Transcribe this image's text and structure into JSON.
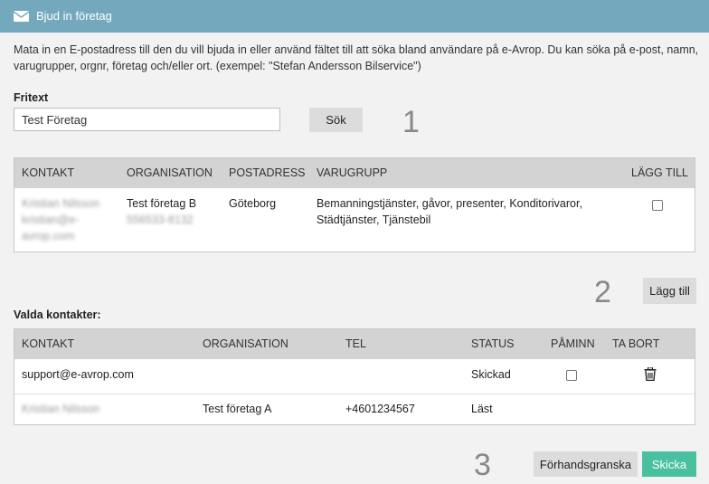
{
  "dialog": {
    "title": "Bjud in företag",
    "icon": "envelope-icon"
  },
  "intro": "Mata in en E-postadress till den du vill bjuda in eller använd fältet till att söka bland användare på e-Avrop. Du kan söka på e-post, namn, varugrupper, orgnr, företag och/eller ort. (exempel: \"Stefan Andersson Bilservice\")",
  "search": {
    "label": "Fritext",
    "value": "Test Företag",
    "button": "Sök"
  },
  "steps": [
    "1",
    "2",
    "3"
  ],
  "results": {
    "columns": [
      "KONTAKT",
      "ORGANISATION",
      "POSTADRESS",
      "VARUGRUPP",
      "LÄGG TILL"
    ],
    "rows": [
      {
        "contact_name": "Kristian Nilsson",
        "contact_email_1": "kristian@e-",
        "contact_email_2": "avrop.com",
        "org": "Test företag B",
        "orgnr": "556533-8132",
        "city": "Göteborg",
        "groups_1": "Bemanningstjänster, gåvor, presenter, Konditorivaror,",
        "groups_2": "Städtjänster, Tjänstebil",
        "add_checked": false
      }
    ]
  },
  "add_button": "Lägg till",
  "selected": {
    "label": "Valda kontakter:",
    "columns": [
      "KONTAKT",
      "ORGANISATION",
      "TEL",
      "STATUS",
      "PÅMINN",
      "TA BORT"
    ],
    "rows": [
      {
        "contact": "support@e-avrop.com",
        "org": "",
        "tel": "",
        "status": "Skickad",
        "remind_checked": false,
        "delete_icon": "trash-icon"
      },
      {
        "contact": "Kristian Nilsson",
        "org": "Test företag A",
        "tel": "+4601234567",
        "status": "Läst"
      }
    ]
  },
  "footer": {
    "preview": "Förhandsgranska",
    "send": "Skicka"
  },
  "colors": {
    "header": "#74a9bd",
    "send_button": "#49c1a0",
    "table_header": "#d3d3d3"
  }
}
